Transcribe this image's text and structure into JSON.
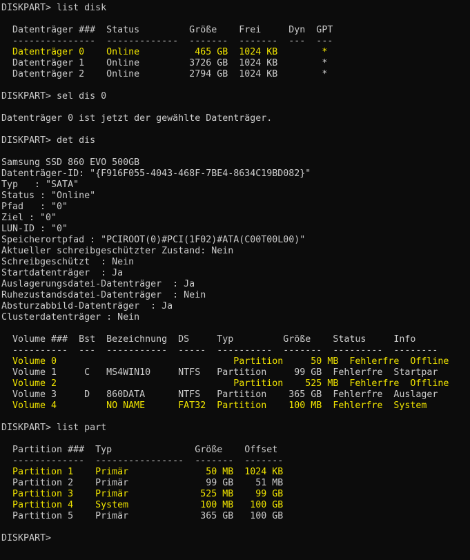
{
  "colors": {
    "background": "#0c0c0c",
    "text": "#cccccc",
    "highlight_text": "#f0e400"
  },
  "lines": [
    {
      "text": "DISKPART> list disk",
      "hl": false
    },
    {
      "text": "",
      "hl": false
    },
    {
      "text": "  Datenträger ###  Status         Größe    Frei     Dyn  GPT",
      "hl": false
    },
    {
      "text": "  ---------------  -------------  -------  -------  ---  ---",
      "hl": false
    },
    {
      "text": "  Datenträger 0    Online          465 GB  1024 KB        *",
      "hl": true
    },
    {
      "text": "  Datenträger 1    Online         3726 GB  1024 KB        *",
      "hl": false
    },
    {
      "text": "  Datenträger 2    Online         2794 GB  1024 KB        *",
      "hl": false
    },
    {
      "text": "",
      "hl": false
    },
    {
      "text": "DISKPART> sel dis 0",
      "hl": false
    },
    {
      "text": "",
      "hl": false
    },
    {
      "text": "Datenträger 0 ist jetzt der gewählte Datenträger.",
      "hl": false
    },
    {
      "text": "",
      "hl": false
    },
    {
      "text": "DISKPART> det dis",
      "hl": false
    },
    {
      "text": "",
      "hl": false
    },
    {
      "text": "Samsung SSD 860 EVO 500GB",
      "hl": false
    },
    {
      "text": "Datenträger-ID: \"{F916F055-4043-468F-7BE4-8634C19BD082}\"",
      "hl": false
    },
    {
      "text": "Typ   : \"SATA\"",
      "hl": false
    },
    {
      "text": "Status : \"Online\"",
      "hl": false
    },
    {
      "text": "Pfad   : \"0\"",
      "hl": false
    },
    {
      "text": "Ziel : \"0\"",
      "hl": false
    },
    {
      "text": "LUN-ID : \"0\"",
      "hl": false
    },
    {
      "text": "Speicherortpfad : \"PCIROOT(0)#PCI(1F02)#ATA(C00T00L00)\"",
      "hl": false
    },
    {
      "text": "Aktueller schreibgeschützter Zustand: Nein",
      "hl": false
    },
    {
      "text": "Schreibgeschützt  : Nein",
      "hl": false
    },
    {
      "text": "Startdatenträger  : Ja",
      "hl": false
    },
    {
      "text": "Auslagerungsdatei-Datenträger  : Ja",
      "hl": false
    },
    {
      "text": "Ruhezustandsdatei-Datenträger  : Nein",
      "hl": false
    },
    {
      "text": "Absturzabbild-Datenträger  : Ja",
      "hl": false
    },
    {
      "text": "Clusterdatenträger : Nein",
      "hl": false
    },
    {
      "text": "",
      "hl": false
    },
    {
      "text": "  Volume ###  Bst  Bezeichnung  DS     Typ         Größe    Status     Info",
      "hl": false
    },
    {
      "text": "  ----------  ---  -----------  -----  ----------  -------  ---------  --------",
      "hl": false
    },
    {
      "text": "  Volume 0                                Partition     50 MB  Fehlerfre  Offline",
      "hl": true
    },
    {
      "text": "  Volume 1     C   MS4WIN10     NTFS   Partition     99 GB  Fehlerfre  Startpar",
      "hl": false
    },
    {
      "text": "  Volume 2                                Partition    525 MB  Fehlerfre  Offline",
      "hl": true
    },
    {
      "text": "  Volume 3     D   860DATA      NTFS   Partition    365 GB  Fehlerfre  Auslager",
      "hl": false
    },
    {
      "text": "  Volume 4         NO NAME      FAT32  Partition    100 MB  Fehlerfre  System",
      "hl": true
    },
    {
      "text": "",
      "hl": false
    },
    {
      "text": "DISKPART> list part",
      "hl": false
    },
    {
      "text": "",
      "hl": false
    },
    {
      "text": "  Partition ###  Typ               Größe    Offset",
      "hl": false
    },
    {
      "text": "  -------------  ----------------  -------  -------",
      "hl": false
    },
    {
      "text": "  Partition 1    Primär              50 MB  1024 KB",
      "hl": true
    },
    {
      "text": "  Partition 2    Primär              99 GB    51 MB",
      "hl": false
    },
    {
      "text": "  Partition 3    Primär             525 MB    99 GB",
      "hl": true
    },
    {
      "text": "  Partition 4    System             100 MB   100 GB",
      "hl": true
    },
    {
      "text": "  Partition 5    Primär             365 GB   100 GB",
      "hl": false
    },
    {
      "text": "",
      "hl": false
    },
    {
      "text": "DISKPART> ",
      "hl": false
    }
  ]
}
